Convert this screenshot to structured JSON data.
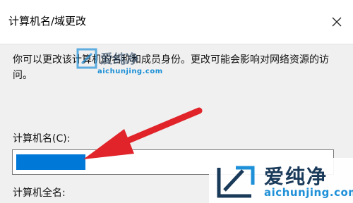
{
  "dialog": {
    "title": "计算机名/域更改",
    "close_icon": "close-icon",
    "description": "你可以更改该计算机的名称和成员身份。更改可能会影响对网络资源的访问。",
    "computer_name_label": "计算机名(C):",
    "computer_name_value": "",
    "full_name_label": "计算机全名:"
  },
  "annotation": {
    "arrow_color": "#e0242a"
  },
  "watermark": {
    "brand_cn": "爱纯净",
    "url": "aichunjing.com",
    "color": "#1e90d8"
  }
}
